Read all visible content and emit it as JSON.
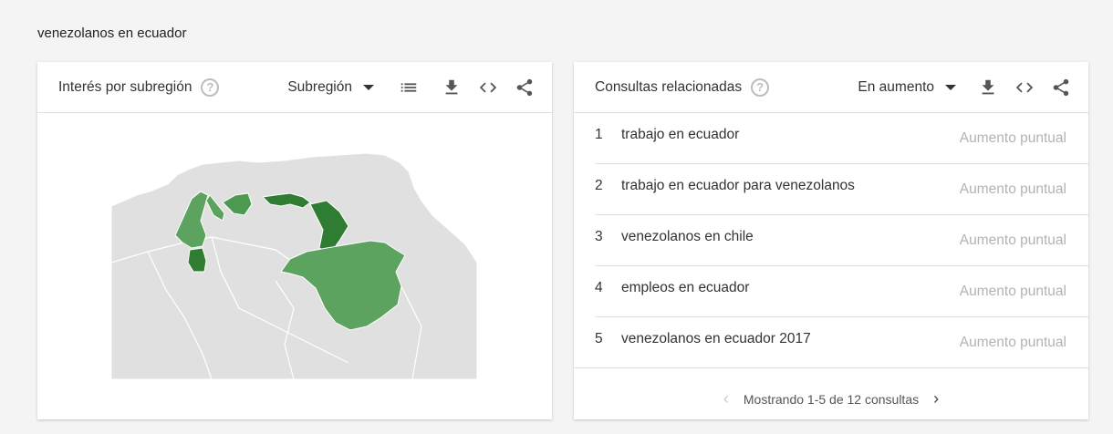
{
  "search_term": "venezolanos en ecuador",
  "left_card": {
    "title": "Interés por subregión",
    "dropdown_label": "Subregión",
    "map_colors": {
      "background": "#e0e0e0",
      "light": "#5ba35f",
      "medium": "#4c9a50",
      "dark": "#2e7d32"
    }
  },
  "right_card": {
    "title": "Consultas relacionadas",
    "dropdown_label": "En aumento",
    "rows": [
      {
        "num": "1",
        "query": "trabajo en ecuador",
        "value": "Aumento puntual"
      },
      {
        "num": "2",
        "query": "trabajo en ecuador para venezolanos",
        "value": "Aumento puntual"
      },
      {
        "num": "3",
        "query": "venezolanos en chile",
        "value": "Aumento puntual"
      },
      {
        "num": "4",
        "query": "empleos en ecuador",
        "value": "Aumento puntual"
      },
      {
        "num": "5",
        "query": "venezolanos en ecuador 2017",
        "value": "Aumento puntual"
      }
    ],
    "pager_text": "Mostrando 1-5 de 12 consultas"
  },
  "icons": {
    "help": "question-circle-icon",
    "list": "list-icon",
    "download": "download-icon",
    "embed": "code-icon",
    "share": "share-icon",
    "prev": "chevron-left-icon",
    "next": "chevron-right-icon"
  }
}
